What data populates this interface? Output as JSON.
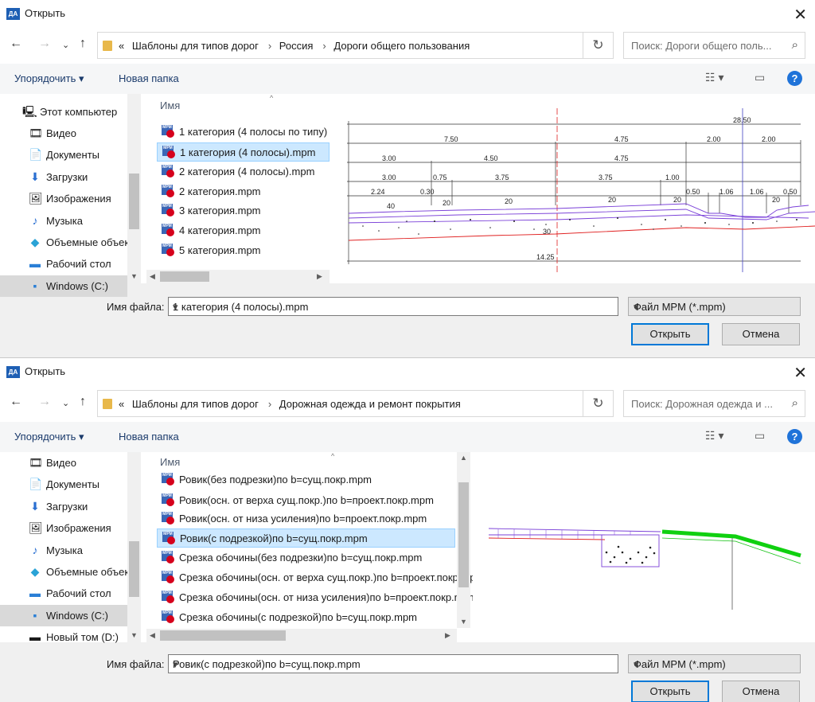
{
  "dialog1": {
    "title": "Открыть",
    "app_icon": "ДА",
    "breadcrumb": [
      "Шаблоны для типов дорог",
      "Россия",
      "Дороги общего пользования"
    ],
    "crumb_prefix": "«",
    "search_placeholder": "Поиск: Дороги общего поль...",
    "toolbar": {
      "organize": "Упорядочить ▾",
      "new_folder": "Новая папка"
    },
    "sidebar": [
      {
        "label": "Этот компьютер",
        "icon": "computer-icon"
      },
      {
        "label": "Видео",
        "icon": "video-icon"
      },
      {
        "label": "Документы",
        "icon": "documents-icon"
      },
      {
        "label": "Загрузки",
        "icon": "downloads-icon"
      },
      {
        "label": "Изображения",
        "icon": "pictures-icon"
      },
      {
        "label": "Музыка",
        "icon": "music-icon"
      },
      {
        "label": "Объемные объекты",
        "icon": "3d-objects-icon"
      },
      {
        "label": "Рабочий стол",
        "icon": "desktop-icon"
      },
      {
        "label": "Windows (C:)",
        "icon": "drive-icon"
      }
    ],
    "column_header": "Имя",
    "files": [
      "1 категория (4 полосы по типу)",
      "1 категория (4 полосы).mpm",
      "2 категория (4 полосы).mpm",
      "2 категория.mpm",
      "3 категория.mpm",
      "4 категория.mpm",
      "5 категория.mpm"
    ],
    "selected_file_index": 1,
    "filename_label": "Имя файла:",
    "filename_value": "1 категория (4 полосы).mpm",
    "filetype": "Файл MPM (*.mpm)",
    "open_label": "Открыть",
    "cancel_label": "Отмена",
    "preview_dims": [
      "28.50",
      "7.50",
      "4.75",
      "2.00",
      "2.00",
      "3.00",
      "4.50",
      "4.75",
      "3.00",
      "0.75",
      "3.75",
      "3.75",
      "1.00",
      "2.24",
      "0.30",
      "0.50",
      "1.06",
      "1.06",
      "0.50",
      "40",
      "20",
      "20",
      "20",
      "20",
      "20",
      "30",
      "14.25"
    ]
  },
  "dialog2": {
    "title": "Открыть",
    "app_icon": "ДА",
    "breadcrumb": [
      "Шаблоны для типов дорог",
      "Дорожная одежда и ремонт покрытия"
    ],
    "crumb_prefix": "«",
    "search_placeholder": "Поиск: Дорожная одежда и ...",
    "toolbar": {
      "organize": "Упорядочить ▾",
      "new_folder": "Новая папка"
    },
    "sidebar": [
      {
        "label": "Видео",
        "icon": "video-icon"
      },
      {
        "label": "Документы",
        "icon": "documents-icon"
      },
      {
        "label": "Загрузки",
        "icon": "downloads-icon"
      },
      {
        "label": "Изображения",
        "icon": "pictures-icon"
      },
      {
        "label": "Музыка",
        "icon": "music-icon"
      },
      {
        "label": "Объемные объекты",
        "icon": "3d-objects-icon"
      },
      {
        "label": "Рабочий стол",
        "icon": "desktop-icon"
      },
      {
        "label": "Windows  (C:)",
        "icon": "drive-icon"
      },
      {
        "label": "Новый том (D:)",
        "icon": "drive-icon"
      }
    ],
    "selected_sidebar_index": 7,
    "column_header": "Имя",
    "files": [
      "Ровик(без подрезки)по b=сущ.покр.mpm",
      "Ровик(осн. от верха сущ.покр.)по b=проект.покр.mpm",
      "Ровик(осн. от низа усиления)по b=проект.покр.mpm",
      "Ровик(с подрезкой)по b=сущ.покр.mpm",
      "Срезка обочины(без подрезки)по b=сущ.покр.mpm",
      "Срезка обочины(осн. от верха сущ.покр.)по b=проект.покр.mpm",
      "Срезка обочины(осн. от низа усиления)по b=проект.покр.mpm",
      "Срезка обочины(с подрезкой)по b=сущ.покр.mpm"
    ],
    "selected_file_index": 3,
    "filename_label": "Имя файла:",
    "filename_value": "Ровик(с подрезкой)по b=сущ.покр.mpm",
    "filetype": "Файл MPM (*.mpm)",
    "open_label": "Открыть",
    "cancel_label": "Отмена"
  },
  "colors": {
    "accent": "#0078d7",
    "selection": "#cce8ff",
    "help": "#1f73d9"
  }
}
